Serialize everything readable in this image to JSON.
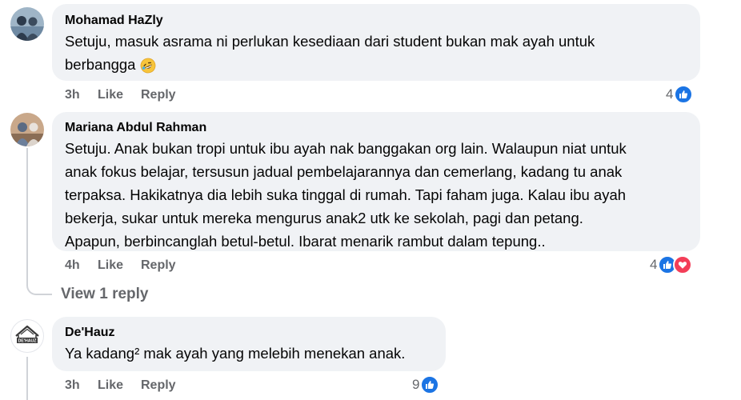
{
  "comments": [
    {
      "author": "Mohamad HaZly",
      "lines": [
        "Setuju, masuk asrama ni perlukan kesediaan dari student bukan mak ayah untuk",
        "berbangga"
      ],
      "emoji": "rolling-on-floor-laughing-emoji",
      "time": "3h",
      "like_label": "Like",
      "reply_label": "Reply",
      "reaction_count": "4",
      "reactions": [
        "like-icon"
      ]
    },
    {
      "author": "Mariana Abdul Rahman",
      "lines": [
        "Setuju. Anak bukan tropi untuk ibu ayah nak banggakan org lain. Walaupun niat untuk",
        "anak fokus belajar, tersusun jadual pembelajarannya dan cemerlang, kadang tu anak",
        "terpaksa. Hakikatnya dia lebih suka tinggal di rumah. Tapi faham juga. Kalau ibu ayah",
        "bekerja, sukar untuk mereka mengurus anak2 utk ke sekolah, pagi dan petang.",
        "Apapun, berbincanglah betul-betul. Ibarat menarik rambut dalam tepung.."
      ],
      "time": "4h",
      "like_label": "Like",
      "reply_label": "Reply",
      "reaction_count": "4",
      "reactions": [
        "like-icon",
        "love-icon"
      ],
      "view_replies_label": "View 1 reply"
    },
    {
      "author": "De'Hauz",
      "avatar_logo_text": "DE'HAUZ",
      "lines": [
        "Ya kadang² mak ayah yang melebih menekan anak."
      ],
      "time": "3h",
      "like_label": "Like",
      "reply_label": "Reply",
      "reaction_count": "9",
      "reactions": [
        "like-icon"
      ]
    }
  ],
  "colors": {
    "bubble": "#f0f2f5",
    "secondary_text": "#65676b",
    "like_blue": "#1b74e4",
    "love_red": "#f33e58",
    "thread_line": "#d0d3d8"
  }
}
